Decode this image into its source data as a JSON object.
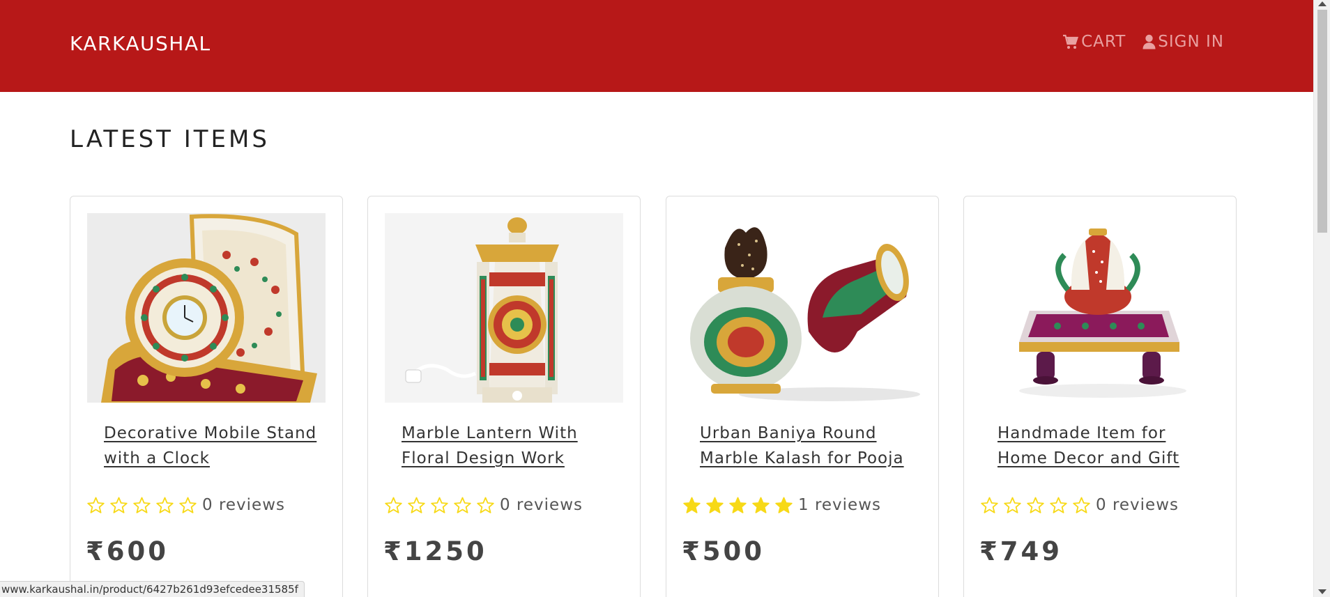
{
  "header": {
    "brand": "KARKAUSHAL",
    "cart_label": "CART",
    "signin_label": "SIGN IN",
    "cart_icon": "cart-icon",
    "user_icon": "user-icon",
    "background_color": "#b71818"
  },
  "main": {
    "section_title": "LATEST ITEMS",
    "products": [
      {
        "title": "Decorative Mobile Stand with a Clock",
        "rating": 0,
        "reviews": "0 reviews",
        "price": "₹600"
      },
      {
        "title": "Marble Lantern With Floral Design Work",
        "rating": 0,
        "reviews": "0 reviews",
        "price": "₹1250"
      },
      {
        "title": "Urban Baniya Round Marble Kalash for Pooja",
        "rating": 5,
        "reviews": "1 reviews",
        "price": "₹500"
      },
      {
        "title": "Handmade Item for Home Decor and Gift",
        "rating": 0,
        "reviews": "0 reviews",
        "price": "₹749"
      }
    ],
    "star_color": "#f7d917"
  },
  "status_bar": {
    "url": "www.karkaushal.in/product/6427b261d93efcedee31585f"
  }
}
